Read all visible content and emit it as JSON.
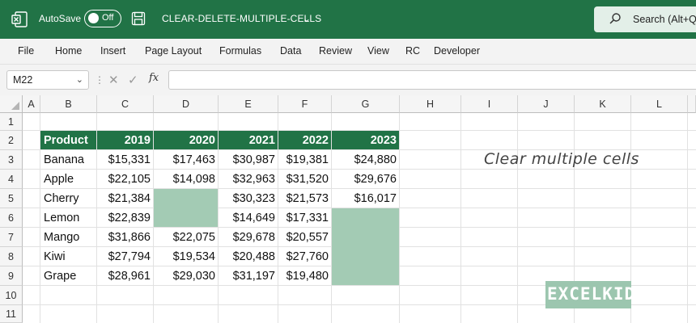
{
  "titlebar": {
    "autosave_label": "AutoSave",
    "toggle_state": "Off",
    "filename": "CLEAR-DELETE-MULTIPLE-CELLS",
    "search_placeholder": "Search (Alt+Q)",
    "bg_color": "#217346"
  },
  "ribbon": {
    "tabs": [
      "File",
      "Home",
      "Insert",
      "Page Layout",
      "Formulas",
      "Data",
      "Review",
      "View",
      "RC",
      "Developer"
    ]
  },
  "formula_bar": {
    "name_box": "M22",
    "fx_label": "fx",
    "value": ""
  },
  "columns": [
    "A",
    "B",
    "C",
    "D",
    "E",
    "F",
    "G",
    "H",
    "I",
    "J",
    "K",
    "L"
  ],
  "rows": [
    "1",
    "2",
    "3",
    "4",
    "5",
    "6",
    "7",
    "8",
    "9",
    "10",
    "11"
  ],
  "table": {
    "headers": [
      "Product",
      "2019",
      "2020",
      "2021",
      "2022",
      "2023"
    ],
    "rows": [
      [
        "Banana",
        "$15,331",
        "$17,463",
        "$30,987",
        "$19,381",
        "$24,880"
      ],
      [
        "Apple",
        "$22,105",
        "$14,098",
        "$32,963",
        "$31,520",
        "$29,676"
      ],
      [
        "Cherry",
        "$21,384",
        "",
        "$30,323",
        "$21,573",
        "$16,017"
      ],
      [
        "Lemon",
        "$22,839",
        "",
        "$14,649",
        "$17,331",
        ""
      ],
      [
        "Mango",
        "$31,866",
        "$22,075",
        "$29,678",
        "$20,557",
        ""
      ],
      [
        "Kiwi",
        "$27,794",
        "$19,534",
        "$20,488",
        "$27,760",
        ""
      ],
      [
        "Grape",
        "$28,961",
        "$29,030",
        "$31,197",
        "$19,480",
        ""
      ]
    ],
    "header_color": "#217346",
    "cleared_color": "#a3cbb4"
  },
  "annotation": "Clear multiple cells",
  "watermark": "EXCELKID.COM"
}
